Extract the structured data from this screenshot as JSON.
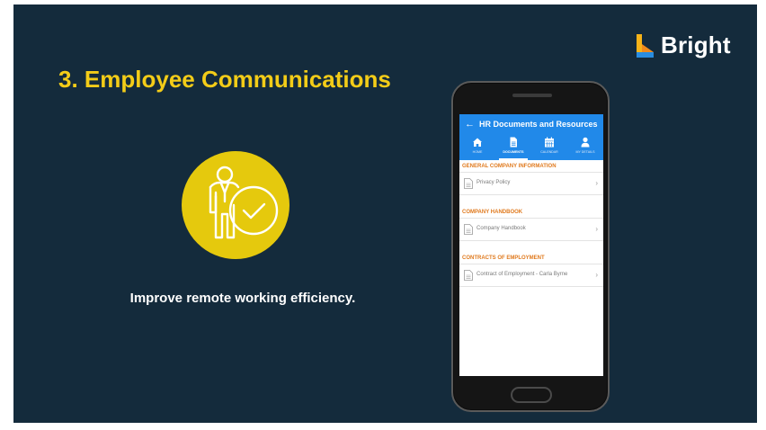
{
  "slide": {
    "title": "3. Employee Communications",
    "subtitle": "Improve remote working efficiency."
  },
  "brand": {
    "name": "Bright",
    "colors": {
      "background": "#142b3c",
      "accent": "#f3cc18",
      "icon_circle": "#e5c90d",
      "app_header": "#2189e9",
      "section_heading": "#e07a1e"
    }
  },
  "app": {
    "back_icon": "arrow-left-icon",
    "title": "HR Documents and Resources",
    "tabs": [
      {
        "label": "HOME",
        "icon": "home-icon"
      },
      {
        "label": "DOCUMENTS",
        "icon": "document-icon",
        "active": true
      },
      {
        "label": "CALENDAR",
        "icon": "calendar-icon"
      },
      {
        "label": "MY DETAILS",
        "icon": "user-icon"
      }
    ],
    "sections": [
      {
        "heading": "GENERAL COMPANY INFORMATION",
        "items": [
          "Privacy Policy"
        ]
      },
      {
        "heading": "COMPANY HANDBOOK",
        "items": [
          "Company Handbook"
        ]
      },
      {
        "heading": "CONTRACTS OF EMPLOYMENT",
        "items": [
          "Contract of Employment - Carla Byrne"
        ]
      }
    ]
  }
}
